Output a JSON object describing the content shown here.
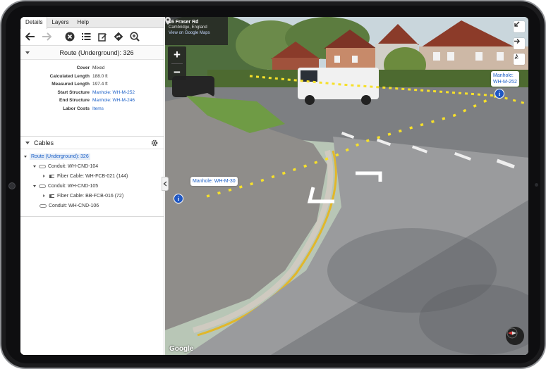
{
  "tabs": [
    "Details",
    "Layers",
    "Help"
  ],
  "toolbar": {
    "icons": [
      "back-arrow-icon",
      "forward-arrow-icon",
      "close-circle-icon",
      "list-icon",
      "edit-icon",
      "directions-icon",
      "zoom-in-icon"
    ]
  },
  "details": {
    "title": "Route (Underground): 326",
    "properties": [
      {
        "label": "Cover",
        "value": "Mixed",
        "link": false
      },
      {
        "label": "Calculated Length",
        "value": "188.0 ft",
        "link": false
      },
      {
        "label": "Measured Length",
        "value": "197.4 ft",
        "link": false
      },
      {
        "label": "Start Structure",
        "value": "Manhole: WH-M-252",
        "link": true
      },
      {
        "label": "End Structure",
        "value": "Manhole: WH-M-246",
        "link": true
      },
      {
        "label": "Labor Costs",
        "value": "Items",
        "link": true
      }
    ]
  },
  "cables": {
    "title": "Cables",
    "root": "Route (Underground): 326",
    "items": [
      {
        "type": "conduit",
        "label": "Conduit: WH-CND-104",
        "expanded": true
      },
      {
        "type": "cable",
        "label": "Fiber Cable: WH-FCB-021 (144)"
      },
      {
        "type": "conduit",
        "label": "Conduit: WH-CND-105",
        "expanded": true
      },
      {
        "type": "cable",
        "label": "Fiber Cable: BB-FCB-016 (72)"
      },
      {
        "type": "conduit",
        "label": "Conduit: WH-CND-106",
        "expanded": false
      }
    ]
  },
  "streetview": {
    "address_title": "16 Fraser Rd",
    "address_sub": "Cambridge, England",
    "maps_link": "View on Google Maps",
    "zoom_in": "+",
    "zoom_out": "−",
    "callout_right": [
      "Manhole:",
      "WH-M-252"
    ],
    "callout_left": "Manhole: WH-M-30",
    "info_symbol": "i",
    "google": "Google",
    "route_color": "#f6e02a",
    "pin_color": "#1f57c3"
  }
}
